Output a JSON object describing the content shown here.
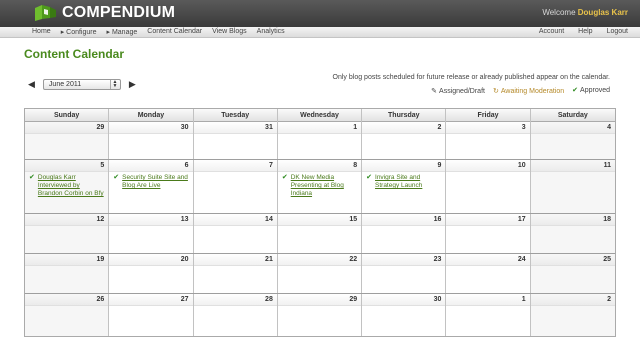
{
  "header": {
    "logo_text": "COMPENDIUM",
    "welcome_prefix": "Welcome",
    "user_name": "Douglas Karr"
  },
  "nav": {
    "left": [
      "Home",
      "▸ Configure",
      "▸ Manage",
      "Content Calendar",
      "View Blogs",
      "Analytics"
    ],
    "right": [
      "Account",
      "Help",
      "Logout"
    ]
  },
  "page": {
    "title": "Content Calendar",
    "month_value": "June 2011",
    "note": "Only blog posts scheduled for future release or already published appear on the calendar.",
    "legend": {
      "draft": "Assigned/Draft",
      "moderation": "Awaiting Moderation",
      "approved": "Approved"
    }
  },
  "calendar": {
    "weekdays": [
      "Sunday",
      "Monday",
      "Tuesday",
      "Wednesday",
      "Thursday",
      "Friday",
      "Saturday"
    ],
    "weeks": [
      [
        "29",
        "30",
        "31",
        "1",
        "2",
        "3",
        "4"
      ],
      [
        "5",
        "6",
        "7",
        "8",
        "9",
        "10",
        "11"
      ],
      [
        "12",
        "13",
        "14",
        "15",
        "16",
        "17",
        "18"
      ],
      [
        "19",
        "20",
        "21",
        "22",
        "23",
        "24",
        "25"
      ],
      [
        "26",
        "27",
        "28",
        "29",
        "30",
        "1",
        "2"
      ]
    ],
    "events": {
      "sun5": "Douglas Karr Interviewed by Brandon Corbin on Bfy",
      "mon6": "Security Suite Site and Blog Are Live",
      "wed8": "DK New Media Presenting at Blog Indiana",
      "thu9": "Invigra Site and Strategy Launch"
    }
  },
  "colors": {
    "brand_green": "#4a8a1e",
    "welcome_name": "#e8c24a",
    "moderation": "#b58a2a"
  }
}
